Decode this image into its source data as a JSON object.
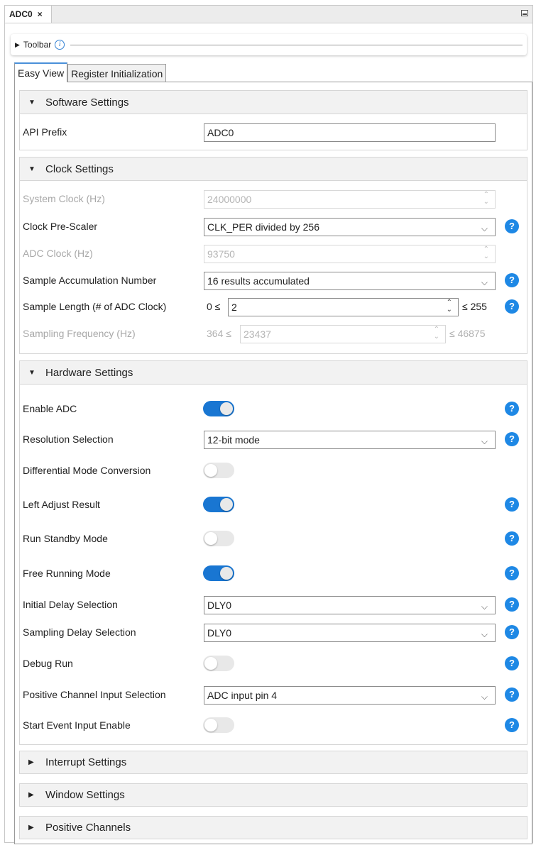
{
  "window": {
    "tab_title": "ADC0",
    "close_glyph": "×"
  },
  "toolbar": {
    "label": "Toolbar",
    "info_glyph": "i"
  },
  "tabs": [
    {
      "label": "Easy View",
      "active": true
    },
    {
      "label": "Register Initialization",
      "active": false
    }
  ],
  "icons": {
    "expanded": "▼",
    "collapsed": "▶",
    "dropdown": "⌵",
    "spin": "⌃\n⌄",
    "help": "?"
  },
  "colors": {
    "accent": "#1e88e5",
    "toggle_on": "#1976d2"
  },
  "software": {
    "title": "Software Settings",
    "api_prefix": {
      "label": "API Prefix",
      "value": "ADC0"
    }
  },
  "clock": {
    "title": "Clock Settings",
    "system_clock": {
      "label": "System Clock (Hz)",
      "value": "24000000"
    },
    "prescaler": {
      "label": "Clock Pre-Scaler",
      "value": "CLK_PER divided by 256"
    },
    "adc_clock": {
      "label": "ADC Clock (Hz)",
      "value": "93750"
    },
    "accumulation": {
      "label": "Sample Accumulation Number",
      "value": "16 results accumulated"
    },
    "sample_length": {
      "label": "Sample Length (# of ADC Clock)",
      "min": "0 ≤",
      "value": "2",
      "max": "≤ 255"
    },
    "sampling_freq": {
      "label": "Sampling Frequency (Hz)",
      "min": "364 ≤",
      "value": "23437",
      "max": "≤ 46875"
    }
  },
  "hardware": {
    "title": "Hardware Settings",
    "enable_adc": {
      "label": "Enable ADC",
      "on": true
    },
    "resolution": {
      "label": "Resolution Selection",
      "value": "12-bit mode"
    },
    "differential": {
      "label": "Differential Mode Conversion",
      "on": false
    },
    "left_adjust": {
      "label": "Left Adjust Result",
      "on": true
    },
    "run_standby": {
      "label": "Run Standby Mode",
      "on": false
    },
    "free_running": {
      "label": "Free Running Mode",
      "on": true
    },
    "initial_delay": {
      "label": "Initial Delay Selection",
      "value": "DLY0"
    },
    "sampling_delay": {
      "label": "Sampling Delay Selection",
      "value": "DLY0"
    },
    "debug_run": {
      "label": "Debug Run",
      "on": false
    },
    "positive_channel": {
      "label": "Positive Channel Input Selection",
      "value": "ADC input pin 4"
    },
    "start_event": {
      "label": "Start Event Input Enable",
      "on": false
    }
  },
  "collapsed_sections": [
    {
      "title": "Interrupt Settings"
    },
    {
      "title": "Window Settings"
    },
    {
      "title": "Positive Channels"
    }
  ]
}
